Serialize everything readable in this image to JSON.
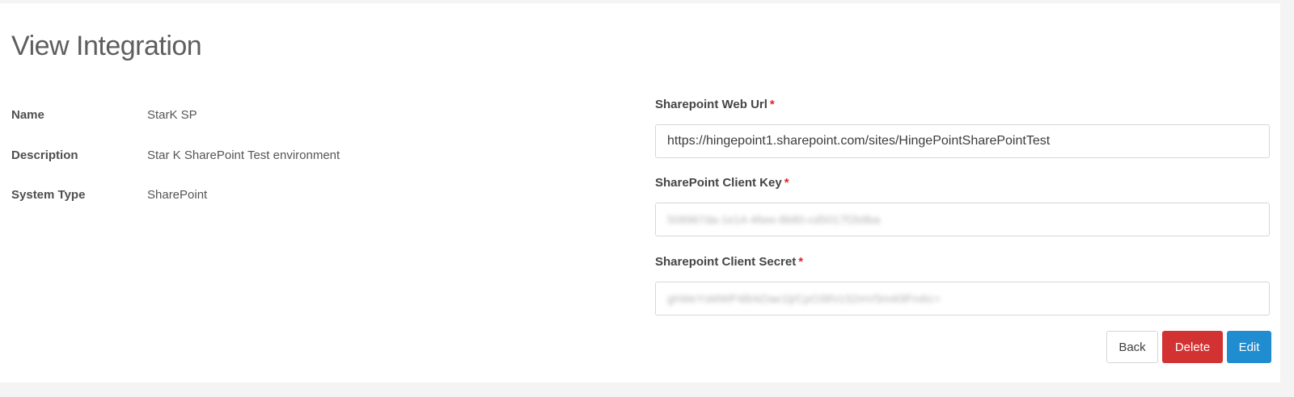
{
  "page": {
    "title": "View Integration"
  },
  "details": [
    {
      "label": "Name",
      "value": "StarK SP"
    },
    {
      "label": "Description",
      "value": "Star K SharePoint Test environment"
    },
    {
      "label": "System Type",
      "value": "SharePoint"
    }
  ],
  "fields": {
    "web_url": {
      "label": "Sharepoint Web Url",
      "required": "*",
      "value": "https://hingepoint1.sharepoint.com/sites/HingePointSharePointTest"
    },
    "client_key": {
      "label": "SharePoint Client Key",
      "required": "*",
      "value": "508967da-1e14-46ee-8b80-cd5017f2b9ba"
    },
    "client_secret": {
      "label": "Sharepoint Client Secret",
      "required": "*",
      "value": "ghWeYsMWP4BrkDae1lj/CpO38Vz32mV5m40lFn4Ic="
    }
  },
  "buttons": {
    "back": "Back",
    "delete": "Delete",
    "edit": "Edit"
  },
  "colors": {
    "required": "#d9262b",
    "delete": "#d33232",
    "edit": "#1f8dd0"
  }
}
